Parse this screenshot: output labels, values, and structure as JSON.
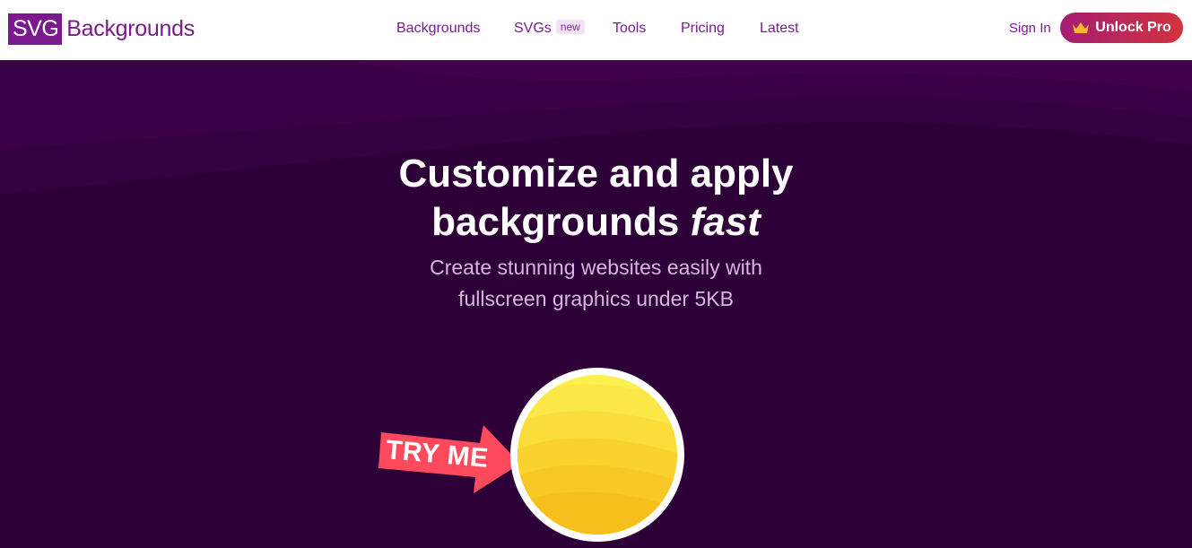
{
  "logo": {
    "box_text": "SVG",
    "text": "Backgrounds"
  },
  "nav": {
    "items": [
      {
        "label": "Backgrounds"
      },
      {
        "label": "SVGs",
        "badge": "new"
      },
      {
        "label": "Tools"
      },
      {
        "label": "Pricing"
      },
      {
        "label": "Latest"
      }
    ]
  },
  "account": {
    "signin_label": "Sign In",
    "unlock_label": "Unlock Pro",
    "unlock_icon": "crown-icon"
  },
  "hero": {
    "title_plain": "Customize and apply",
    "title_line2": "backgrounds ",
    "title_emphasis": "fast",
    "subtitle_line1": "Create stunning websites easily with",
    "subtitle_line2": "fullscreen graphics under 5KB",
    "try_me": "TRY ME"
  },
  "colors": {
    "brand": "#7a1a8c",
    "hero_bg": "#2e0038",
    "unlock_gradient_start": "#a51d73",
    "unlock_gradient_end": "#d2333f",
    "tryme_arrow": "#ff4a5e",
    "ball_yellow": "#fbd51f"
  }
}
